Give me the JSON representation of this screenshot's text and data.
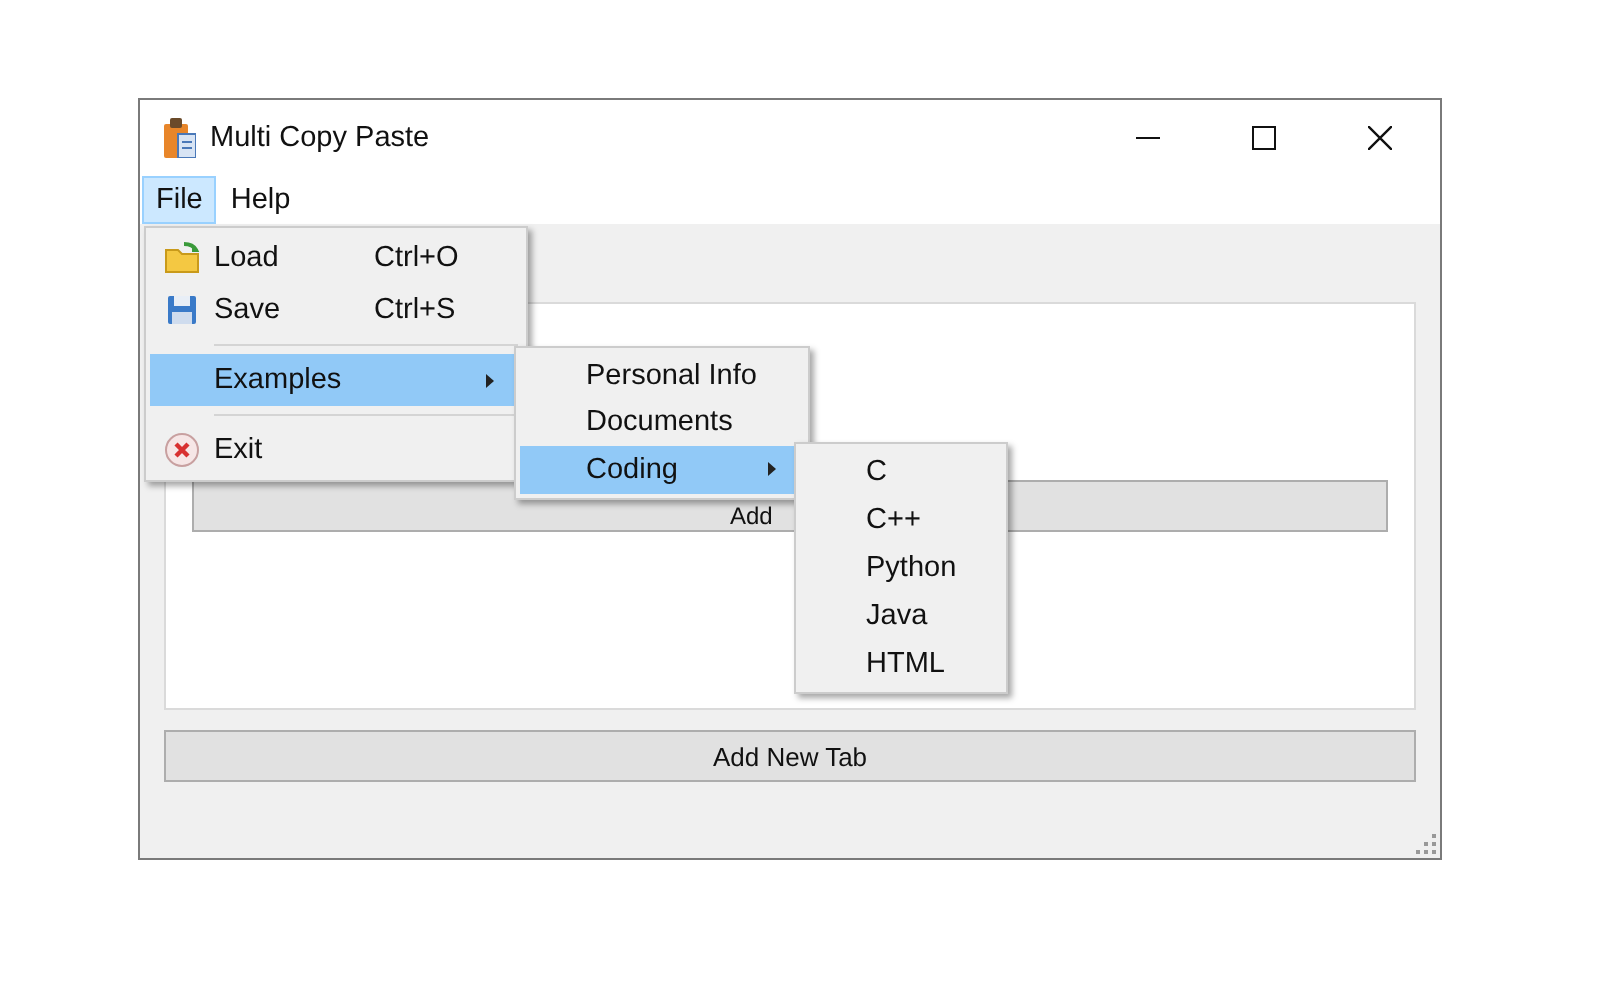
{
  "window": {
    "title": "Multi Copy Paste"
  },
  "menubar": [
    {
      "label": "File",
      "selected": true
    },
    {
      "label": "Help",
      "selected": false
    }
  ],
  "file_menu": [
    {
      "kind": "item",
      "label": "Load",
      "shortcut": "Ctrl+O",
      "selected": false,
      "submenu": false
    },
    {
      "kind": "item",
      "label": "Save",
      "shortcut": "Ctrl+S",
      "selected": false,
      "submenu": false
    },
    {
      "kind": "separator"
    },
    {
      "kind": "item",
      "label": "Examples",
      "selected": true,
      "submenu": true
    },
    {
      "kind": "separator"
    },
    {
      "kind": "item",
      "label": "Exit",
      "selected": false,
      "submenu": false
    }
  ],
  "examples_menu": [
    {
      "kind": "item",
      "label": "Personal Info",
      "selected": false,
      "submenu": false
    },
    {
      "kind": "item",
      "label": "Documents",
      "selected": false,
      "submenu": false
    },
    {
      "kind": "item",
      "label": "Coding",
      "selected": true,
      "submenu": true
    }
  ],
  "coding_menu": [
    {
      "kind": "item",
      "label": "C",
      "selected": false,
      "submenu": false
    },
    {
      "kind": "item",
      "label": "C++",
      "selected": false,
      "submenu": false
    },
    {
      "kind": "item",
      "label": "Python",
      "selected": false,
      "submenu": false
    },
    {
      "kind": "item",
      "label": "Java",
      "selected": false,
      "submenu": false
    },
    {
      "kind": "item",
      "label": "HTML",
      "selected": false,
      "submenu": false
    }
  ],
  "panel": {
    "button": "Add"
  },
  "add_tab_button": "Add New Tab"
}
